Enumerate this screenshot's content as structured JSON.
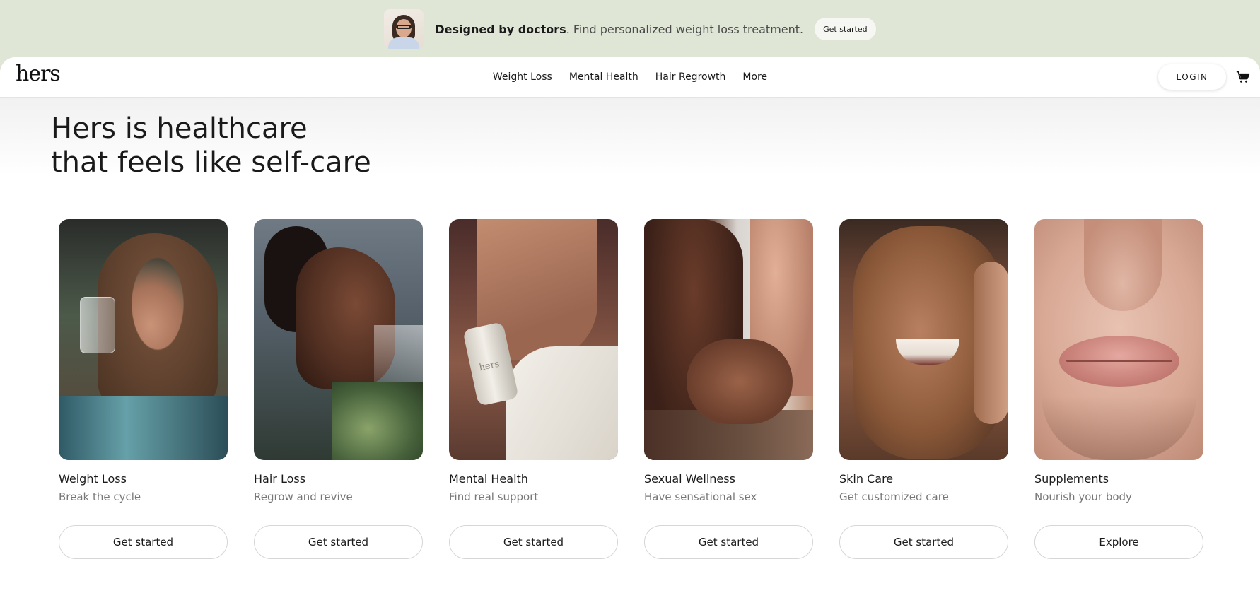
{
  "promo": {
    "bold_text": "Designed by doctors",
    "text": ". Find personalized weight loss treatment.",
    "button_label": "Get started"
  },
  "nav": {
    "logo": "hers",
    "links": [
      "Weight Loss",
      "Mental Health",
      "Hair Regrowth",
      "More"
    ],
    "login_label": "LOGIN"
  },
  "hero": {
    "headline_line1": "Hers is healthcare",
    "headline_line2": "that feels like self-care"
  },
  "cards": [
    {
      "title": "Weight Loss",
      "subtitle": "Break the cycle",
      "button": "Get started"
    },
    {
      "title": "Hair Loss",
      "subtitle": "Regrow and revive",
      "button": "Get started"
    },
    {
      "title": "Mental Health",
      "subtitle": "Find real support",
      "button": "Get started"
    },
    {
      "title": "Sexual Wellness",
      "subtitle": "Have sensational sex",
      "button": "Get started"
    },
    {
      "title": "Skin Care",
      "subtitle": "Get customized care",
      "button": "Get started"
    },
    {
      "title": "Supplements",
      "subtitle": "Nourish your body",
      "button": "Explore"
    }
  ],
  "product_label": "hers",
  "colors": {
    "banner_bg": "#dfe6d6",
    "page_bg": "#ffffff",
    "muted_text": "#777777"
  },
  "icons": {
    "cart": "cart-icon"
  }
}
